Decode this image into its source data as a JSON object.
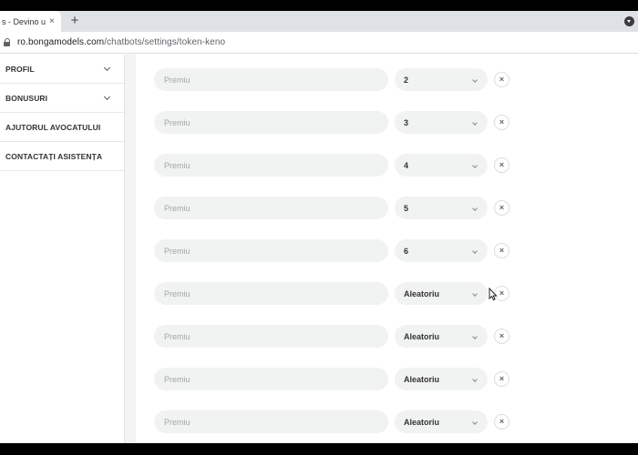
{
  "browser": {
    "tab_title": "s - Devino un",
    "tab_close_glyph": "×",
    "new_tab_glyph": "+",
    "url_host": "ro.bongamodels.com",
    "url_path": "/chatbots/settings/token-keno"
  },
  "sidebar": {
    "items": [
      {
        "label": "PROFIL",
        "icon": "chevron-down-icon"
      },
      {
        "label": "BONUSURI",
        "icon": "chevron-down-icon"
      },
      {
        "label": "AJUTORUL AVOCATULUI"
      },
      {
        "label": "CONTACTAȚI ASISTENȚA"
      }
    ]
  },
  "prize_rows": [
    {
      "placeholder": "Premiu",
      "selected": "2"
    },
    {
      "placeholder": "Premiu",
      "selected": "3"
    },
    {
      "placeholder": "Premiu",
      "selected": "4"
    },
    {
      "placeholder": "Premiu",
      "selected": "5"
    },
    {
      "placeholder": "Premiu",
      "selected": "6"
    },
    {
      "placeholder": "Premiu",
      "selected": "Aleatoriu"
    },
    {
      "placeholder": "Premiu",
      "selected": "Aleatoriu"
    },
    {
      "placeholder": "Premiu",
      "selected": "Aleatoriu"
    },
    {
      "placeholder": "Premiu",
      "selected": "Aleatoriu"
    }
  ],
  "remove_glyph": "×"
}
